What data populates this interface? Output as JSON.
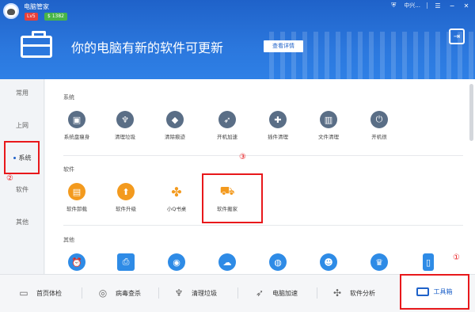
{
  "header": {
    "app_title": "电脑管家",
    "level_badge": "Lv5",
    "coin_badge": "$ 1382",
    "topbar": {
      "account": "中兴...",
      "menu_icon": "menu-icon",
      "min_icon": "minimize-icon",
      "close_icon": "close-icon"
    },
    "banner_text": "你的电脑有新的软件可更新",
    "detail_button": "查看详情"
  },
  "leftnav": {
    "items": [
      {
        "label": "常用"
      },
      {
        "label": "上网"
      },
      {
        "label": "系统"
      },
      {
        "label": "软件"
      },
      {
        "label": "其他"
      }
    ]
  },
  "sections": {
    "system": {
      "title": "系统",
      "tools": [
        {
          "label": "系统盘瘦身",
          "icon": "disk-slim-icon"
        },
        {
          "label": "清理垃圾",
          "icon": "broom-icon"
        },
        {
          "label": "清除痕迹",
          "icon": "eraser-icon"
        },
        {
          "label": "开机加速",
          "icon": "rocket-icon"
        },
        {
          "label": "插件清理",
          "icon": "puzzle-icon"
        },
        {
          "label": "文件清理",
          "icon": "trash-file-icon"
        },
        {
          "label": "开机很",
          "icon": "power-icon"
        }
      ]
    },
    "software": {
      "title": "软件",
      "tools": [
        {
          "label": "软件卸载",
          "icon": "uninstall-icon"
        },
        {
          "label": "软件升级",
          "icon": "upgrade-icon"
        },
        {
          "label": "小Q书桌",
          "icon": "clover-icon"
        },
        {
          "label": "软件搬家",
          "icon": "moving-truck-icon"
        }
      ]
    },
    "other": {
      "title": "其他",
      "tools": [
        {
          "label": "",
          "icon": "alarm-clock-icon"
        },
        {
          "label": "",
          "icon": "printer-icon"
        },
        {
          "label": "",
          "icon": "mouse-icon"
        },
        {
          "label": "",
          "icon": "cloud-icon"
        },
        {
          "label": "",
          "icon": "ufo-icon"
        },
        {
          "label": "",
          "icon": "user-support-icon"
        },
        {
          "label": "",
          "icon": "crown-icon"
        },
        {
          "label": "",
          "icon": "phone-icon"
        }
      ]
    }
  },
  "bottombar": {
    "items": [
      {
        "label": "首页体检",
        "icon": "monitor-check-icon"
      },
      {
        "label": "病毒查杀",
        "icon": "virus-scan-icon"
      },
      {
        "label": "清理垃圾",
        "icon": "broom-icon"
      },
      {
        "label": "电脑加速",
        "icon": "rocket-icon"
      },
      {
        "label": "软件分析",
        "icon": "fan-icon"
      },
      {
        "label": "工具箱",
        "icon": "toolbox-icon"
      }
    ]
  },
  "annotations": {
    "mark_1": "①",
    "mark_2": "②",
    "mark_3": "③"
  },
  "colors": {
    "brand_blue": "#1f62c9",
    "annotation_red": "#e8181b",
    "orange": "#f39a1e",
    "slate": "#5a6e86"
  }
}
